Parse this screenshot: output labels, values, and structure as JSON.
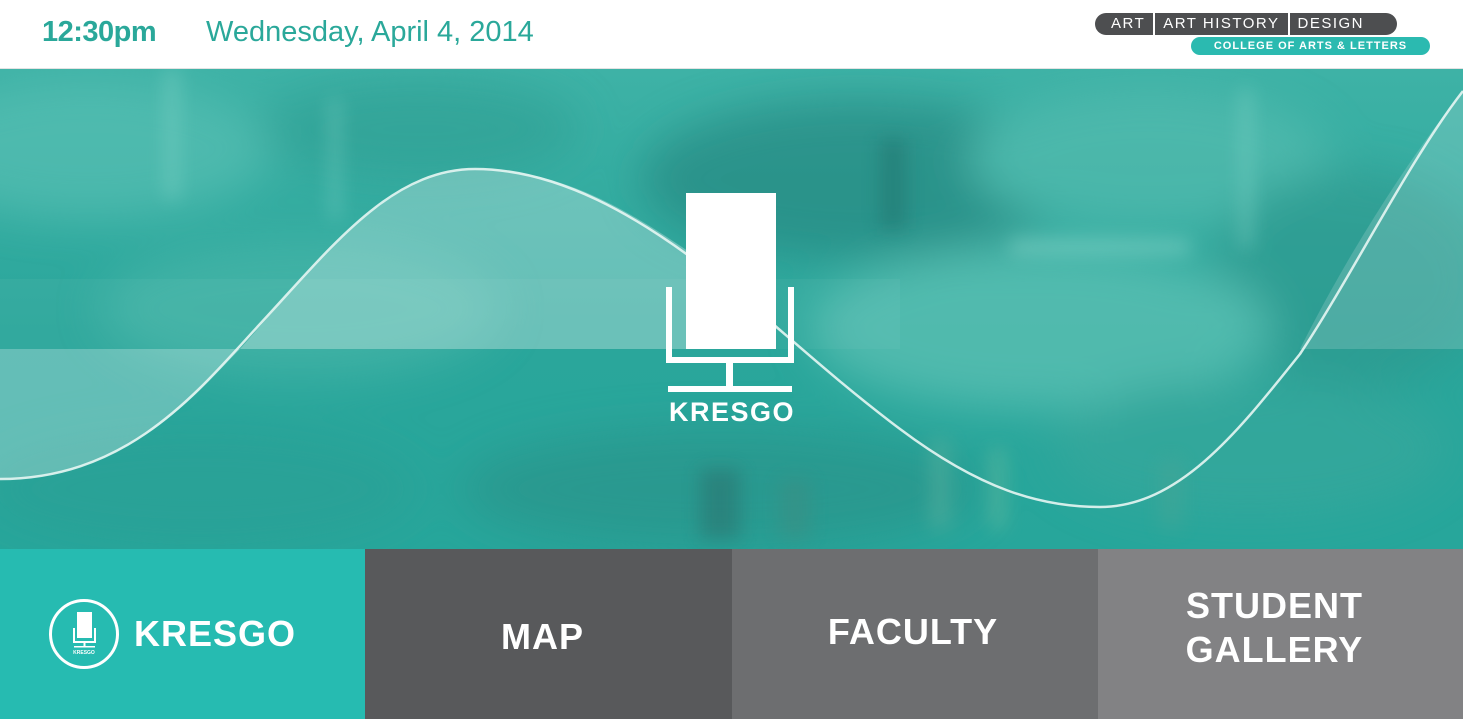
{
  "header": {
    "time": "12:30pm",
    "date": "Wednesday, April 4, 2014",
    "departments": [
      "ART",
      "ART HISTORY",
      "DESIGN"
    ],
    "college": "COLLEGE OF ARTS & LETTERS"
  },
  "hero": {
    "logo_title": "KRESGO",
    "logo_icon": "monitor-stand-icon"
  },
  "nav": {
    "tiles": [
      {
        "label": "KRESGO",
        "icon": "kresgo-badge-icon",
        "active": true
      },
      {
        "label": "MAP"
      },
      {
        "label": "FACULTY"
      },
      {
        "label": "STUDENT GALLERY"
      }
    ],
    "badge_caption": "KRESGO"
  },
  "colors": {
    "accent": "#2aa89a",
    "teal_tile": "#26bbb1",
    "dark_grey": "#58595b",
    "mid_grey": "#6d6e70",
    "light_grey": "#828284",
    "dept_bar": "#4d4e50"
  }
}
